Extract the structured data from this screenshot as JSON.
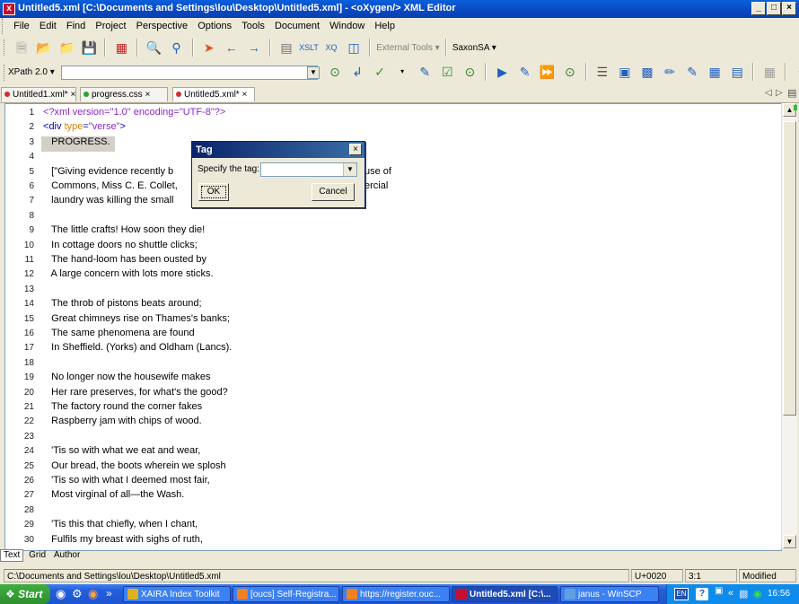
{
  "window": {
    "title": "Untitled5.xml [C:\\Documents and Settings\\lou\\Desktop\\Untitled5.xml] - <oXygen/> XML Editor",
    "controls": [
      "_",
      "□",
      "×"
    ]
  },
  "menu": [
    "File",
    "Edit",
    "Find",
    "Project",
    "Perspective",
    "Options",
    "Tools",
    "Document",
    "Window",
    "Help"
  ],
  "toolbar1": {
    "external_tools": "External Tools",
    "transformer": "SaxonSA"
  },
  "toolbar2": {
    "xpath_label": "XPath 2.0",
    "xpath_value": ""
  },
  "tabs": [
    {
      "label": "Untitled1.xml*",
      "dot_color": "#d03030"
    },
    {
      "label": "progress.css",
      "dot_color": "#30a030"
    },
    {
      "label": "Untitled5.xml*",
      "dot_color": "#d03030"
    }
  ],
  "editor": {
    "lines": [
      {
        "n": "1",
        "text": "<?xml version=\"1.0\" encoding=\"UTF-8\"?>"
      },
      {
        "n": "2",
        "text": "<div type=\"verse\">"
      },
      {
        "n": "3",
        "text": "   PROGRESS."
      },
      {
        "n": "4",
        "text": ""
      },
      {
        "n": "5",
        "text": "   [\"Giving evidence recently b"
      },
      {
        "n": "6",
        "text": "   Commons, Miss C. E. Collet,"
      },
      {
        "n": "7",
        "text": "   laundry was killing the small"
      },
      {
        "n": "8",
        "text": ""
      },
      {
        "n": "9",
        "text": "   The little crafts! How soon they die!"
      },
      {
        "n": "10",
        "text": "   In cottage doors no shuttle clicks;"
      },
      {
        "n": "11",
        "text": "   The hand-loom has been ousted by"
      },
      {
        "n": "12",
        "text": "   A large concern with lots more sticks."
      },
      {
        "n": "13",
        "text": ""
      },
      {
        "n": "14",
        "text": "   The throb of pistons beats around;"
      },
      {
        "n": "15",
        "text": "   Great chimneys rise on Thames's banks;"
      },
      {
        "n": "16",
        "text": "   The same phenomena are found"
      },
      {
        "n": "17",
        "text": "   In Sheffield. (Yorks) and Oldham (Lancs)."
      },
      {
        "n": "18",
        "text": ""
      },
      {
        "n": "19",
        "text": "   No longer now the housewife makes"
      },
      {
        "n": "20",
        "text": "   Her rare preserves, for what's the good?"
      },
      {
        "n": "21",
        "text": "   The factory round the corner fakes"
      },
      {
        "n": "22",
        "text": "   Raspberry jam with chips of wood."
      },
      {
        "n": "23",
        "text": ""
      },
      {
        "n": "24",
        "text": "   'Tis so with what we eat and wear,"
      },
      {
        "n": "25",
        "text": "   Our bread, the boots wherein we splosh"
      },
      {
        "n": "26",
        "text": "   'Tis so with what I deemed most fair,"
      },
      {
        "n": "27",
        "text": "   Most virginal of all—the Wash."
      },
      {
        "n": "28",
        "text": ""
      },
      {
        "n": "29",
        "text": "   'Tis this that chiefly, when I chant,"
      },
      {
        "n": "30",
        "text": "   Fulfils my breast with sighs of ruth,"
      }
    ],
    "line1_parts": {
      "open": "<?xml version=\"1.0\" encoding=\"UTF-8\"?>"
    },
    "line2_parts": {
      "lt": "<",
      "tag": "div",
      "sp": " ",
      "attr": "type",
      "eq": "=",
      "val": "\"verse\"",
      "gt": ">"
    },
    "hidden_behind_dialog": {
      "line5_tail": "use of",
      "line6_tail": "ercial"
    }
  },
  "dialog": {
    "title": "Tag",
    "label": "Specify the tag:",
    "value": "",
    "ok": "OK",
    "cancel": "Cancel",
    "close": "×"
  },
  "modes": [
    "Text",
    "Grid",
    "Author"
  ],
  "status": {
    "path": "C:\\Documents and Settings\\lou\\Desktop\\Untitled5.xml",
    "char": "U+0020",
    "pos": "3:1",
    "state": "Modified"
  },
  "taskbar": {
    "start": "Start",
    "more": "»",
    "tasks": [
      {
        "label": "XAIRA Index Toolkit",
        "color": "#e0b020",
        "active": false
      },
      {
        "label": "[oucs] Self-Registra...",
        "color": "#f08020",
        "active": false
      },
      {
        "label": "https://register.ouc...",
        "color": "#f08020",
        "active": false
      },
      {
        "label": "Untitled5.xml [C:\\...",
        "color": "#c8102e",
        "active": true
      },
      {
        "label": "janus - WinSCP",
        "color": "#60a0e0",
        "active": false
      }
    ],
    "tray": {
      "lang": "EN",
      "help": "?",
      "more": "«",
      "time": "16:56"
    }
  }
}
